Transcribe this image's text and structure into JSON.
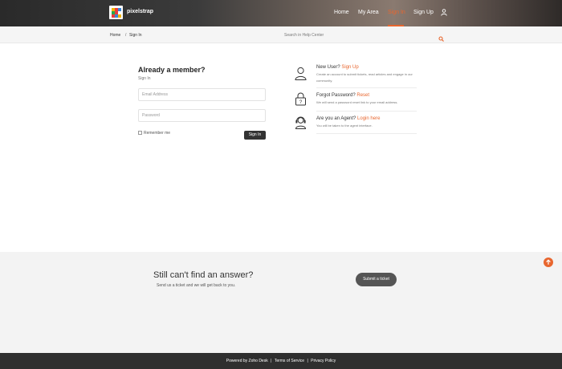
{
  "header": {
    "brand": "pixelstrap",
    "nav": [
      {
        "label": "Home"
      },
      {
        "label": "My Area"
      },
      {
        "label": "Sign In",
        "active": true
      },
      {
        "label": "Sign Up"
      }
    ],
    "accent": "#e8662e"
  },
  "breadcrumb": {
    "home": "Home",
    "separator": "/",
    "current": "Sign In",
    "search_placeholder": "Search in Help Center"
  },
  "login": {
    "title": "Already a member?",
    "subtitle": "Sign In",
    "email_placeholder": "Email Address",
    "password_placeholder": "Password",
    "remember_label": "Remember me",
    "signin_button": "Sign In"
  },
  "info": {
    "new_user": {
      "title": "New User?",
      "link": "Sign Up",
      "desc": "Create an account to submit tickets, read articles and engage in our community."
    },
    "forgot": {
      "title": "Forgot Password?",
      "link": "Reset",
      "desc": "We will send a password reset link to your email address."
    },
    "agent": {
      "title": "Are you an Agent?",
      "link": "Login here",
      "desc": "You will be taken to the agent interface."
    }
  },
  "cta": {
    "title": "Still can't find an answer?",
    "subtitle": "Send us a ticket and we will get back to you.",
    "button": "Submit a ticket"
  },
  "footer": {
    "powered": "Powered by Zoho Desk",
    "sep": "|",
    "terms": "Terms of Service",
    "privacy": "Privacy Policy"
  }
}
